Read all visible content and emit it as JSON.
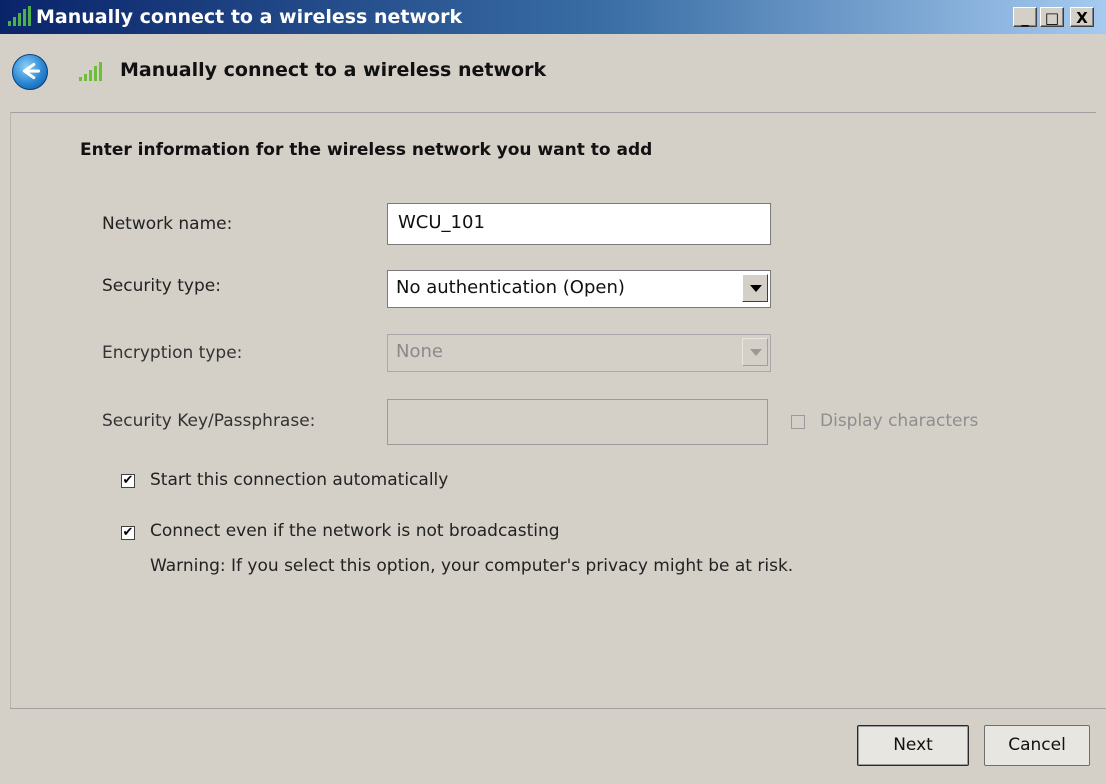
{
  "window": {
    "title": "Manually connect to a wireless network",
    "controls": {
      "minimize": "_",
      "maximize": "□",
      "close": "X"
    },
    "title_icon": "wifi-signal-icon"
  },
  "nav": {
    "back_icon": "back-arrow-icon",
    "icon": "wifi-signal-icon",
    "title": "Manually connect to a wireless network"
  },
  "form": {
    "heading": "Enter information for the wireless network you want to add",
    "network_name": {
      "label": "Network name:",
      "value": "WCU_101"
    },
    "security_type": {
      "label": "Security type:",
      "value": "No authentication (Open)"
    },
    "encryption_type": {
      "label": "Encryption type:",
      "value": "None"
    },
    "security_key": {
      "label": "Security Key/Passphrase:",
      "value": ""
    },
    "display_characters": {
      "label": "Display characters",
      "checked": false
    },
    "start_auto": {
      "label": "Start this connection automatically",
      "checked": true
    },
    "connect_hidden": {
      "label": "Connect even if the network is not broadcasting",
      "checked": true
    },
    "warning": "Warning: If you select this option, your computer's privacy might be at risk."
  },
  "footer": {
    "next_label": "Next",
    "cancel_label": "Cancel"
  },
  "colors": {
    "titlebar_start": "#0a246a",
    "titlebar_end": "#a6caf0",
    "dialog_bg": "#d4d0c8"
  }
}
